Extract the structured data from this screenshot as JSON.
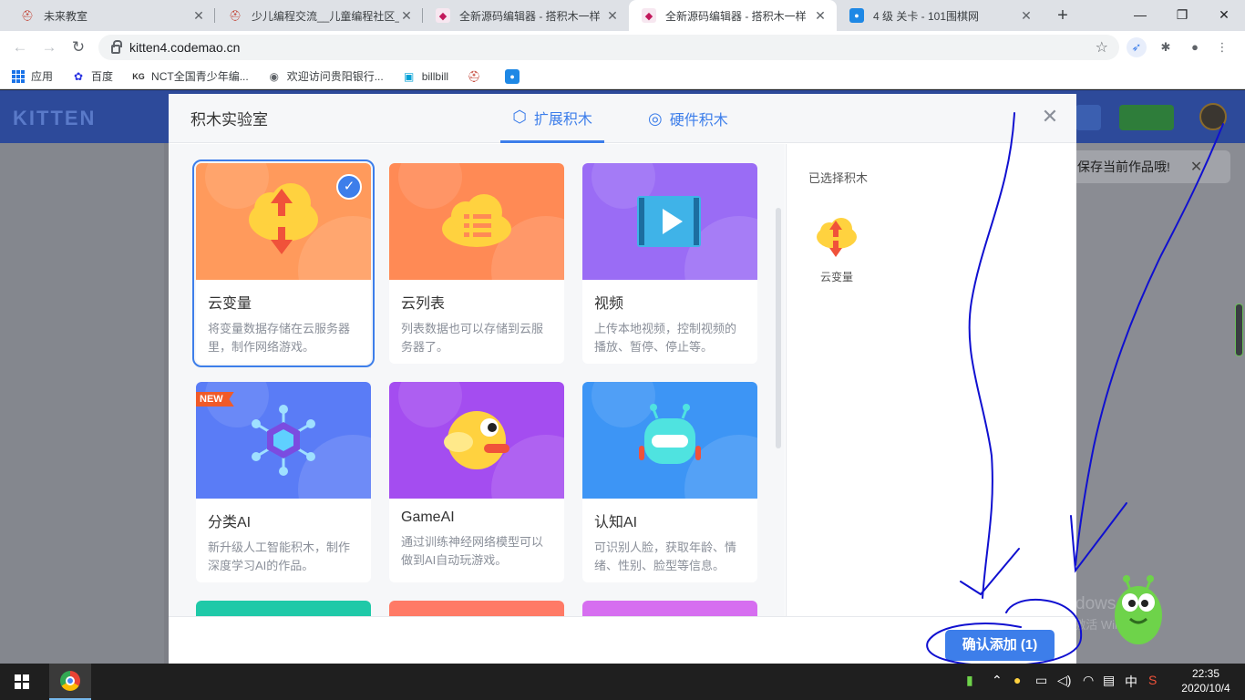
{
  "browser": {
    "tabs": [
      {
        "title": "未来教室",
        "icon": "codemao-icon",
        "active": false
      },
      {
        "title": "少儿编程交流__儿童编程社区_",
        "icon": "codemao-icon",
        "active": false
      },
      {
        "title": "全新源码编辑器 - 搭积木一样",
        "icon": "kitten-icon",
        "active": false
      },
      {
        "title": "全新源码编辑器 - 搭积木一样",
        "icon": "kitten-icon",
        "active": true
      },
      {
        "title": "4 级 关卡 - 101围棋网",
        "icon": "go-icon",
        "active": false
      }
    ],
    "new_tab": "+",
    "window_controls": {
      "minimize": "—",
      "maximize": "❐",
      "close": "✕"
    },
    "url": "kitten4.codemao.cn",
    "bookmarks": [
      {
        "label": "应用",
        "icon": "apps-icon"
      },
      {
        "label": "百度",
        "icon": "baidu-icon"
      },
      {
        "label": "NCT全国青少年编...",
        "icon": "nct-icon"
      },
      {
        "label": "欢迎访问贵阳银行...",
        "icon": "globe-icon"
      },
      {
        "label": "billbill",
        "icon": "bilibili-icon"
      },
      {
        "label": "",
        "icon": "codemao-icon"
      },
      {
        "label": "",
        "icon": "101-icon"
      }
    ]
  },
  "background_page": {
    "logo": "KITTEN",
    "toast": "保存当前作品哦!",
    "toast_close": "✕",
    "watermark_line1": "激活 Windows",
    "watermark_line2": "转到\"设置\"以激活 Windows。"
  },
  "dialog": {
    "title": "积木实验室",
    "tabs": [
      {
        "label": "扩展积木",
        "icon": "extension-blocks-icon",
        "active": true
      },
      {
        "label": "硬件积木",
        "icon": "hardware-robot-icon",
        "active": false
      }
    ],
    "close": "✕",
    "cards": [
      {
        "name": "云变量",
        "desc": "将变量数据存储在云服务器里，制作网络游戏。",
        "color": "#ff9a5c",
        "icon": "cloud-variable-icon",
        "selected": true,
        "badge": ""
      },
      {
        "name": "云列表",
        "desc": "列表数据也可以存储到云服务器了。",
        "color": "#ff8a55",
        "icon": "cloud-list-icon",
        "selected": false,
        "badge": ""
      },
      {
        "name": "视频",
        "desc": "上传本地视频，控制视频的播放、暂停、停止等。",
        "color": "#9a6cf5",
        "icon": "video-play-icon",
        "selected": false,
        "badge": ""
      },
      {
        "name": "分类AI",
        "desc": "新升级人工智能积木，制作深度学习AI的作品。",
        "color": "#5a7cf6",
        "icon": "classification-ai-icon",
        "selected": false,
        "badge": "NEW"
      },
      {
        "name": "GameAI",
        "desc": "通过训练神经网络模型可以做到AI自动玩游戏。",
        "color": "#a44df0",
        "icon": "flappy-bird-icon",
        "selected": false,
        "badge": ""
      },
      {
        "name": "认知AI",
        "desc": "可识别人脸，获取年龄、情绪、性别、脸型等信息。",
        "color": "#3d95f5",
        "icon": "robot-face-icon",
        "selected": false,
        "badge": ""
      }
    ],
    "partial_card_colors": [
      "#1fc9a8",
      "#ff7a66",
      "#d66ef0"
    ],
    "sidebar_title": "已选择积木",
    "selected_items": [
      {
        "name": "云变量",
        "icon": "cloud-variable-icon"
      }
    ],
    "confirm_button": "确认添加 (1)"
  },
  "taskbar": {
    "clock_time": "22:35",
    "clock_date": "2020/10/4",
    "ime": "中",
    "tray_icons": [
      "battery-icon",
      "chevron-up-icon",
      "wifi-icon",
      "power-icon",
      "volume-icon",
      "network-icon",
      "notification-icon",
      "sogou-icon"
    ]
  },
  "colors": {
    "accent": "#3d7eea",
    "annotation_ink": "#1010d0"
  }
}
